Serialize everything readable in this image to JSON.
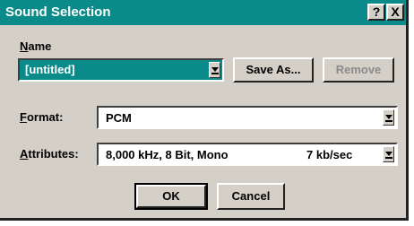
{
  "dialog": {
    "title": "Sound Selection",
    "help_label": "?",
    "close_label": "X"
  },
  "name": {
    "label": "Name",
    "value": "[untitled]",
    "save_as_label": "Save As...",
    "remove_label": "Remove"
  },
  "format": {
    "label": "Format:",
    "value": "PCM"
  },
  "attributes": {
    "label": "Attributes:",
    "value": "8,000 kHz, 8 Bit, Mono",
    "rate": "7 kb/sec"
  },
  "buttons": {
    "ok_label": "OK",
    "cancel_label": "Cancel"
  },
  "colors": {
    "title_bar": "#0a8a88",
    "selection": "#0a8a88",
    "face": "#d4d0c8"
  }
}
